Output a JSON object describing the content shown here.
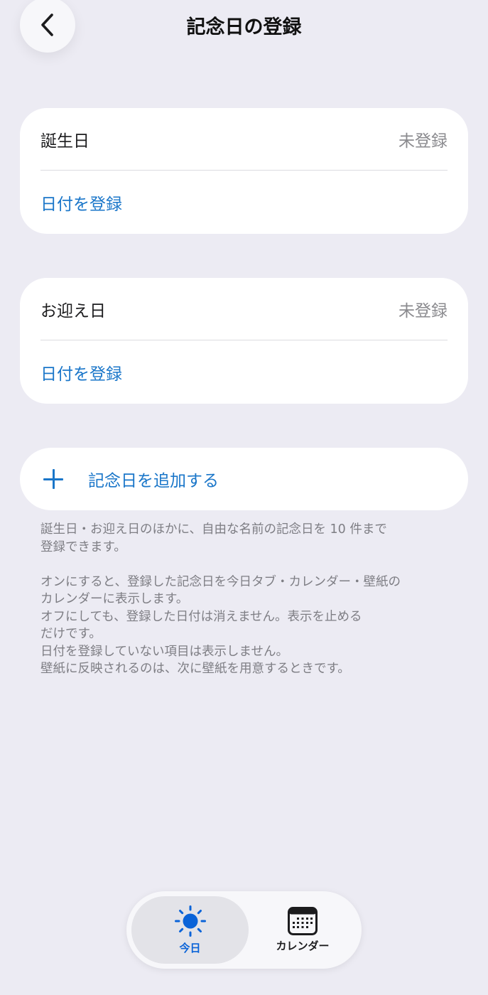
{
  "header": {
    "title": "記念日の登録"
  },
  "cards": [
    {
      "label": "誕生日",
      "status": "未登録",
      "action": "日付を登録"
    },
    {
      "label": "お迎え日",
      "status": "未登録",
      "action": "日付を登録"
    }
  ],
  "add": {
    "label": "記念日を追加する"
  },
  "notes": {
    "p1": "誕生日・お迎え日のほかに、自由な名前の記念日を 10 件まで\n登録できます。",
    "p2": "オンにすると、登録した記念日を今日タブ・カレンダー・壁紙の\nカレンダーに表示します。\nオフにしても、登録した日付は消えません。表示を止める\nだけです。\n日付を登録していない項目は表示しません。\n壁紙に反映されるのは、次に壁紙を用意するときです。"
  },
  "tabs": {
    "today": {
      "label": "今日",
      "icon": "sun-icon"
    },
    "calendar": {
      "label": "カレンダー",
      "icon": "calendar-icon"
    }
  },
  "colors": {
    "accent": "#1A76C9",
    "tab_active": "#0A63D8",
    "background": "#ECEBF3"
  }
}
